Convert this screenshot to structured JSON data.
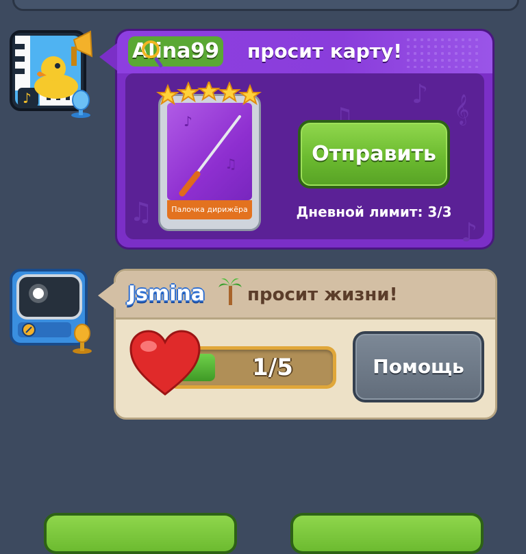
{
  "card_request": {
    "username": "Alina99",
    "request_text": "просит карту!",
    "card_name": "Палочка дирижёра",
    "card_stars": 5,
    "send_button_label": "Отправить",
    "daily_limit": "Дневной лимит: 3/3"
  },
  "life_request": {
    "username": "Jsmina",
    "request_text": "просит жизни!",
    "lives_count": "1/5",
    "lives_fill_fraction": 0.2,
    "help_button_label": "Помощь"
  },
  "colors": {
    "background": "#3d4a5f",
    "card_panel": "#7b2fc7",
    "send_button": "#6cbb30",
    "life_panel": "#ede1c7",
    "help_button": "#626d7b",
    "heart": "#e02a2a"
  },
  "icons": {
    "card_request_avatar": "duck-music-icon",
    "life_request_avatar": "retro-tv-icon",
    "heart": "heart-icon",
    "star": "star-icon"
  }
}
